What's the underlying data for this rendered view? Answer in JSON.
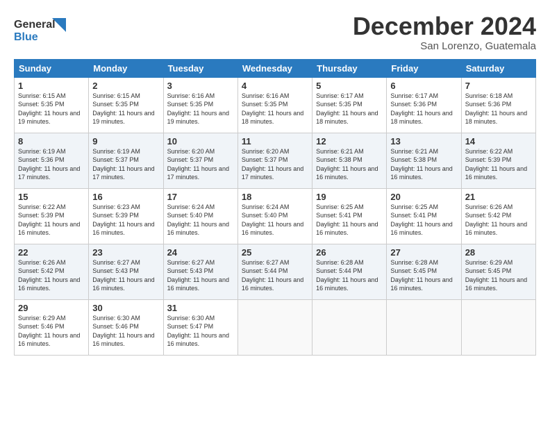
{
  "header": {
    "logo_line1": "General",
    "logo_line2": "Blue",
    "month_title": "December 2024",
    "location": "San Lorenzo, Guatemala"
  },
  "days_of_week": [
    "Sunday",
    "Monday",
    "Tuesday",
    "Wednesday",
    "Thursday",
    "Friday",
    "Saturday"
  ],
  "weeks": [
    [
      {
        "day": "1",
        "sunrise": "6:15 AM",
        "sunset": "5:35 PM",
        "daylight": "11 hours and 19 minutes."
      },
      {
        "day": "2",
        "sunrise": "6:15 AM",
        "sunset": "5:35 PM",
        "daylight": "11 hours and 19 minutes."
      },
      {
        "day": "3",
        "sunrise": "6:16 AM",
        "sunset": "5:35 PM",
        "daylight": "11 hours and 19 minutes."
      },
      {
        "day": "4",
        "sunrise": "6:16 AM",
        "sunset": "5:35 PM",
        "daylight": "11 hours and 18 minutes."
      },
      {
        "day": "5",
        "sunrise": "6:17 AM",
        "sunset": "5:35 PM",
        "daylight": "11 hours and 18 minutes."
      },
      {
        "day": "6",
        "sunrise": "6:17 AM",
        "sunset": "5:36 PM",
        "daylight": "11 hours and 18 minutes."
      },
      {
        "day": "7",
        "sunrise": "6:18 AM",
        "sunset": "5:36 PM",
        "daylight": "11 hours and 18 minutes."
      }
    ],
    [
      {
        "day": "8",
        "sunrise": "6:19 AM",
        "sunset": "5:36 PM",
        "daylight": "11 hours and 17 minutes."
      },
      {
        "day": "9",
        "sunrise": "6:19 AM",
        "sunset": "5:37 PM",
        "daylight": "11 hours and 17 minutes."
      },
      {
        "day": "10",
        "sunrise": "6:20 AM",
        "sunset": "5:37 PM",
        "daylight": "11 hours and 17 minutes."
      },
      {
        "day": "11",
        "sunrise": "6:20 AM",
        "sunset": "5:37 PM",
        "daylight": "11 hours and 17 minutes."
      },
      {
        "day": "12",
        "sunrise": "6:21 AM",
        "sunset": "5:38 PM",
        "daylight": "11 hours and 16 minutes."
      },
      {
        "day": "13",
        "sunrise": "6:21 AM",
        "sunset": "5:38 PM",
        "daylight": "11 hours and 16 minutes."
      },
      {
        "day": "14",
        "sunrise": "6:22 AM",
        "sunset": "5:39 PM",
        "daylight": "11 hours and 16 minutes."
      }
    ],
    [
      {
        "day": "15",
        "sunrise": "6:22 AM",
        "sunset": "5:39 PM",
        "daylight": "11 hours and 16 minutes."
      },
      {
        "day": "16",
        "sunrise": "6:23 AM",
        "sunset": "5:39 PM",
        "daylight": "11 hours and 16 minutes."
      },
      {
        "day": "17",
        "sunrise": "6:24 AM",
        "sunset": "5:40 PM",
        "daylight": "11 hours and 16 minutes."
      },
      {
        "day": "18",
        "sunrise": "6:24 AM",
        "sunset": "5:40 PM",
        "daylight": "11 hours and 16 minutes."
      },
      {
        "day": "19",
        "sunrise": "6:25 AM",
        "sunset": "5:41 PM",
        "daylight": "11 hours and 16 minutes."
      },
      {
        "day": "20",
        "sunrise": "6:25 AM",
        "sunset": "5:41 PM",
        "daylight": "11 hours and 16 minutes."
      },
      {
        "day": "21",
        "sunrise": "6:26 AM",
        "sunset": "5:42 PM",
        "daylight": "11 hours and 16 minutes."
      }
    ],
    [
      {
        "day": "22",
        "sunrise": "6:26 AM",
        "sunset": "5:42 PM",
        "daylight": "11 hours and 16 minutes."
      },
      {
        "day": "23",
        "sunrise": "6:27 AM",
        "sunset": "5:43 PM",
        "daylight": "11 hours and 16 minutes."
      },
      {
        "day": "24",
        "sunrise": "6:27 AM",
        "sunset": "5:43 PM",
        "daylight": "11 hours and 16 minutes."
      },
      {
        "day": "25",
        "sunrise": "6:27 AM",
        "sunset": "5:44 PM",
        "daylight": "11 hours and 16 minutes."
      },
      {
        "day": "26",
        "sunrise": "6:28 AM",
        "sunset": "5:44 PM",
        "daylight": "11 hours and 16 minutes."
      },
      {
        "day": "27",
        "sunrise": "6:28 AM",
        "sunset": "5:45 PM",
        "daylight": "11 hours and 16 minutes."
      },
      {
        "day": "28",
        "sunrise": "6:29 AM",
        "sunset": "5:45 PM",
        "daylight": "11 hours and 16 minutes."
      }
    ],
    [
      {
        "day": "29",
        "sunrise": "6:29 AM",
        "sunset": "5:46 PM",
        "daylight": "11 hours and 16 minutes."
      },
      {
        "day": "30",
        "sunrise": "6:30 AM",
        "sunset": "5:46 PM",
        "daylight": "11 hours and 16 minutes."
      },
      {
        "day": "31",
        "sunrise": "6:30 AM",
        "sunset": "5:47 PM",
        "daylight": "11 hours and 16 minutes."
      },
      null,
      null,
      null,
      null
    ]
  ]
}
